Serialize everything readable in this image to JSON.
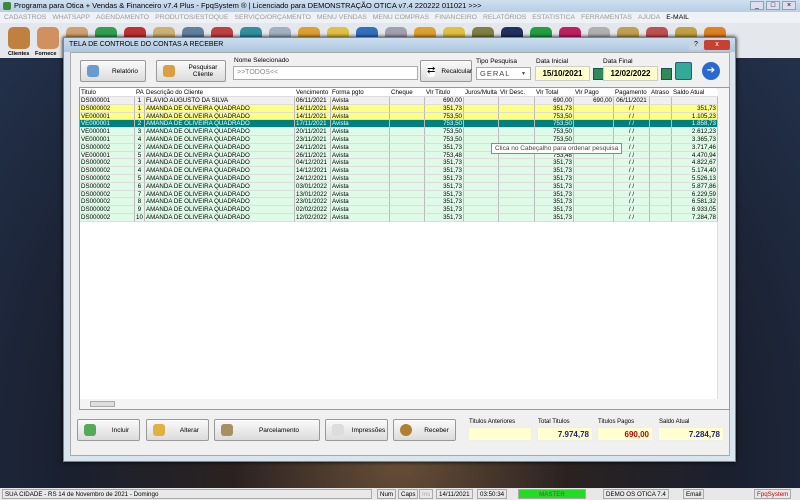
{
  "window": {
    "title": "Programa para Otica + Vendas & Financeiro v7.4 Plus - FpqSystem ® | Licenciado para  DEMONSTRAÇÃO OTICA v7.4 220222 011021 >>>"
  },
  "menu": [
    "CADASTROS",
    "WHATSAPP",
    "AGENDAMENTO",
    "PRODUTOS/ESTOQUE",
    "SERVIÇO/ORÇAMENTO",
    "MENU VENDAS",
    "MENU COMPRAS",
    "FINANCEIRO",
    "RELATÓRIOS",
    "ESTATISTICA",
    "FERRAMENTAS",
    "AJUDA",
    "E-MAIL"
  ],
  "toolbar": {
    "clientes": "Clientes",
    "fornece": "Fornece"
  },
  "modal": {
    "title": "TELA DE CONTROLE DO CONTAS A RECEBER",
    "help": "?",
    "close": "x"
  },
  "controls": {
    "relatorio": "Relatório",
    "pesquisar": "Pesquisar Cliente",
    "nome_label": "Nome Selecionado",
    "nome_value": ">>TODOS<<",
    "recalcular": "Recalcular",
    "tipo_label": "Tipo  Pesquisa",
    "tipo_value": "GERAL",
    "data_inicial_label": "Data Inicial",
    "data_inicial": "15/10/2021",
    "data_final_label": "Data Final",
    "data_final": "12/02/2022"
  },
  "table": {
    "headers": [
      "Titulo",
      "PA",
      "Descrição do Cliente",
      "Vencimento",
      "Forma pgto",
      "Cheque",
      "Vlr Titulo",
      "Juros/Multa",
      "Vlr Desc.",
      "Vlr Total",
      "Vlr Pago",
      "Pagamento",
      "Atraso",
      "Saldo Atual"
    ],
    "rows": [
      [
        "DS000001",
        "1",
        "FLÁVIO AUGUSTO DA SILVA",
        "06/11/2021",
        "Avista",
        "",
        "690,00",
        "",
        "",
        "690,00",
        "690,00",
        "06/11/2021",
        "",
        "",
        "paid"
      ],
      [
        "DS000002",
        "1",
        "AMANDA DE OLIVEIRA QUADRADO",
        "14/11/2021",
        "Avista",
        "",
        "351,73",
        "",
        "",
        "351,73",
        "",
        "/ /",
        "",
        "351,73",
        "due"
      ],
      [
        "VE000001",
        "1",
        "AMANDA DE OLIVEIRA QUADRADO",
        "14/11/2021",
        "Avista",
        "",
        "753,50",
        "",
        "",
        "753,50",
        "",
        "/ /",
        "",
        "1.105,23",
        "due"
      ],
      [
        "VE000001",
        "2",
        "AMANDA DE OLIVEIRA QUADRADO",
        "17/11/2021",
        "Avista",
        "",
        "753,50",
        "",
        "",
        "753,50",
        "",
        "/ /",
        "",
        "1.858,73",
        "selected"
      ],
      [
        "VE000001",
        "3",
        "AMANDA DE OLIVEIRA QUADRADO",
        "20/11/2021",
        "Avista",
        "",
        "753,50",
        "",
        "",
        "753,50",
        "",
        "/ /",
        "",
        "2.612,23",
        "open"
      ],
      [
        "VE000001",
        "4",
        "AMANDA DE OLIVEIRA QUADRADO",
        "23/11/2021",
        "Avista",
        "",
        "753,50",
        "",
        "",
        "753,50",
        "",
        "/ /",
        "",
        "3.365,73",
        "open"
      ],
      [
        "DS000002",
        "2",
        "AMANDA DE OLIVEIRA QUADRADO",
        "24/11/2021",
        "Avista",
        "",
        "351,73",
        "",
        "",
        "351,73",
        "",
        "/ /",
        "",
        "3.717,46",
        "open"
      ],
      [
        "VE000001",
        "5",
        "AMANDA DE OLIVEIRA QUADRADO",
        "26/11/2021",
        "Avista",
        "",
        "753,48",
        "",
        "",
        "753,48",
        "",
        "/ /",
        "",
        "4.470,94",
        "open"
      ],
      [
        "DS000002",
        "3",
        "AMANDA DE OLIVEIRA QUADRADO",
        "04/12/2021",
        "Avista",
        "",
        "351,73",
        "",
        "",
        "351,73",
        "",
        "/ /",
        "",
        "4.822,67",
        "open"
      ],
      [
        "DS000002",
        "4",
        "AMANDA DE OLIVEIRA QUADRADO",
        "14/12/2021",
        "Avista",
        "",
        "351,73",
        "",
        "",
        "351,73",
        "",
        "/ /",
        "",
        "5.174,40",
        "open"
      ],
      [
        "DS000002",
        "5",
        "AMANDA DE OLIVEIRA QUADRADO",
        "24/12/2021",
        "Avista",
        "",
        "351,73",
        "",
        "",
        "351,73",
        "",
        "/ /",
        "",
        "5.526,13",
        "open"
      ],
      [
        "DS000002",
        "6",
        "AMANDA DE OLIVEIRA QUADRADO",
        "03/01/2022",
        "Avista",
        "",
        "351,73",
        "",
        "",
        "351,73",
        "",
        "/ /",
        "",
        "5.877,86",
        "open"
      ],
      [
        "DS000002",
        "7",
        "AMANDA DE OLIVEIRA QUADRADO",
        "13/01/2022",
        "Avista",
        "",
        "351,73",
        "",
        "",
        "351,73",
        "",
        "/ /",
        "",
        "6.229,59",
        "open"
      ],
      [
        "DS000002",
        "8",
        "AMANDA DE OLIVEIRA QUADRADO",
        "23/01/2022",
        "Avista",
        "",
        "351,73",
        "",
        "",
        "351,73",
        "",
        "/ /",
        "",
        "6.581,32",
        "open"
      ],
      [
        "DS000002",
        "9",
        "AMANDA DE OLIVEIRA QUADRADO",
        "02/02/2022",
        "Avista",
        "",
        "351,73",
        "",
        "",
        "351,73",
        "",
        "/ /",
        "",
        "6.933,05",
        "open"
      ],
      [
        "DS000002",
        "10",
        "AMANDA DE OLIVEIRA QUADRADO",
        "12/02/2022",
        "Avista",
        "",
        "351,73",
        "",
        "",
        "351,73",
        "",
        "/ /",
        "",
        "7.284,78",
        "open"
      ]
    ],
    "tooltip": "Clica no Cabeçalho para ordenar pesquisa"
  },
  "row_colors": {
    "paid": "#f0f0f0",
    "due": "#ffff80",
    "selected": "#008080",
    "open": "#e0fae8"
  },
  "actions": {
    "incluir": "Incluir",
    "alterar": "Alterar",
    "parcelamento": "Parcelamento",
    "impressoes": "Impressões",
    "receber": "Receber"
  },
  "summary": {
    "anteriores_label": "Titulos Anteriores",
    "anteriores": "",
    "total_label": "Total Titulos",
    "total": "7.974,78",
    "pagos_label": "Titulos Pagos",
    "pagos": "690,00",
    "saldo_label": "Saldo Atual",
    "saldo": "7.284,78"
  },
  "statusbar": {
    "city": "SUA CIDADE - RS 14 de Novembro de 2021 - Domingo",
    "num": "Num",
    "caps": "Caps",
    "ins": "Ins",
    "date": "14/11/2021",
    "time": "03:50:34",
    "user": "MASTER",
    "version": "DEMO OS OTICA 7.4",
    "email": "Email",
    "brand": "FpqSystem"
  }
}
